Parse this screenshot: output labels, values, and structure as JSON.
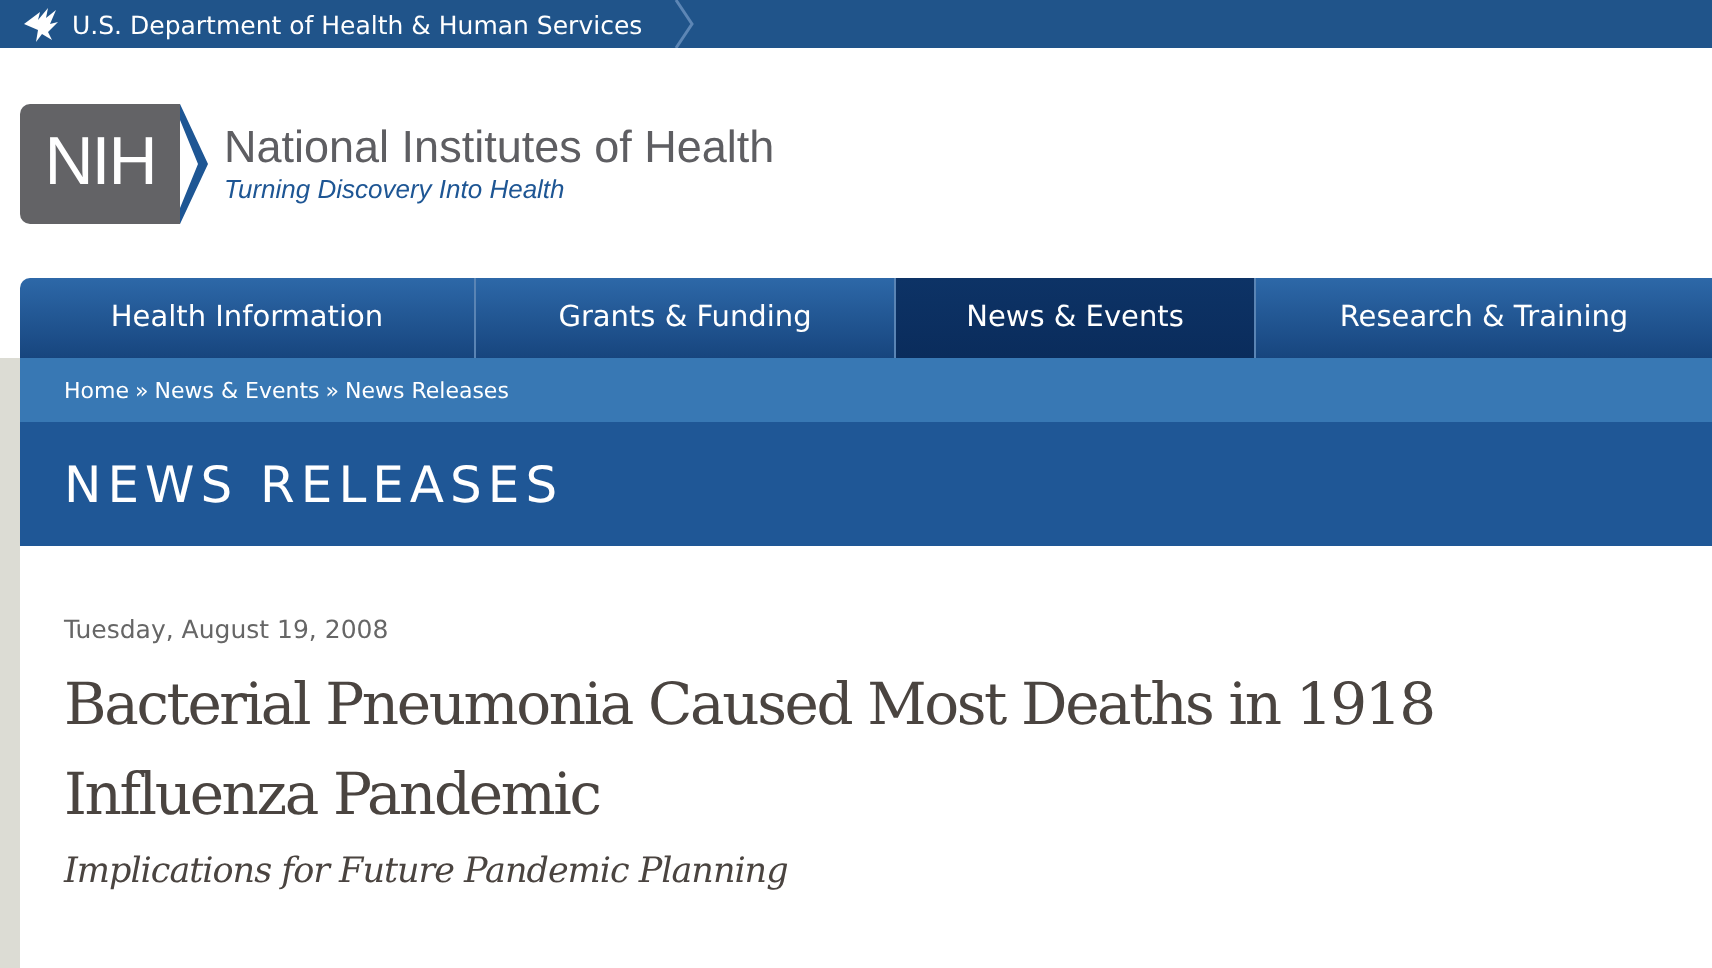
{
  "agency_bar": {
    "label": "U.S. Department of Health & Human Services"
  },
  "logo": {
    "mark": "NIH",
    "name": "National Institutes of Health",
    "tagline": "Turning Discovery Into Health"
  },
  "nav": [
    {
      "label": "Health Information",
      "selected": false
    },
    {
      "label": "Grants & Funding",
      "selected": false
    },
    {
      "label": "News & Events",
      "selected": true
    },
    {
      "label": "Research & Training",
      "selected": false
    }
  ],
  "breadcrumb": [
    {
      "label": "Home"
    },
    {
      "label": "News & Events"
    },
    {
      "label": "News Releases"
    }
  ],
  "breadcrumb_separator": "»",
  "section_title": "NEWS RELEASES",
  "article": {
    "date": "Tuesday, August 19, 2008",
    "title": "Bacterial Pneumonia Caused Most Deaths in 1918 Influenza Pandemic",
    "subtitle": "Implications for Future Pandemic Planning"
  }
}
